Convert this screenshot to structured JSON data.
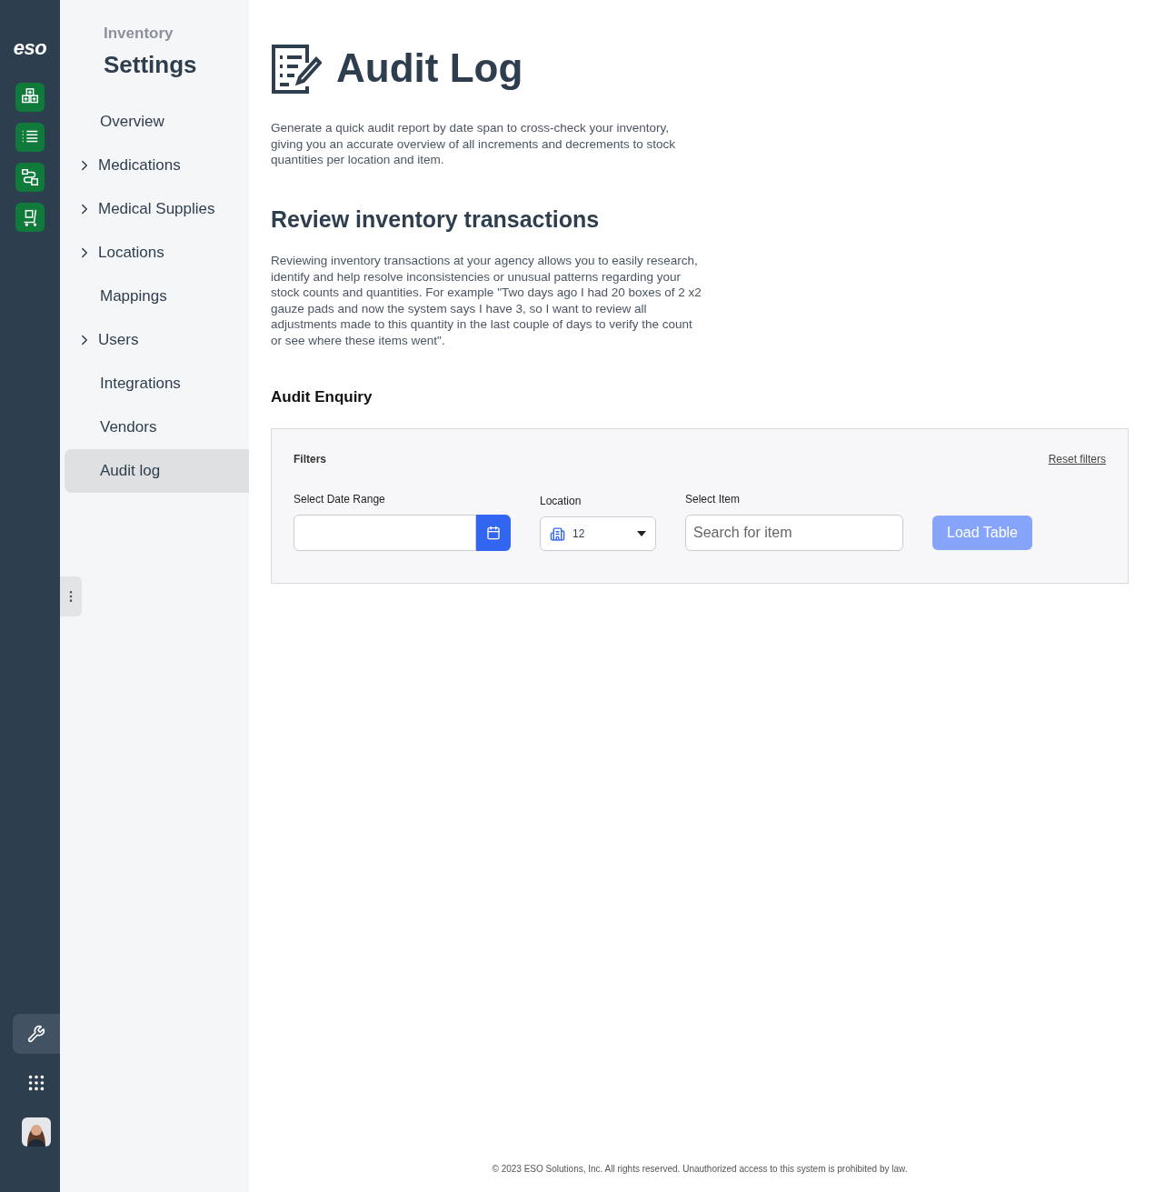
{
  "rail": {
    "logo": "eso",
    "apps": [
      {
        "kind": "boxes"
      },
      {
        "kind": "list"
      },
      {
        "kind": "flow"
      },
      {
        "kind": "cart"
      }
    ],
    "bottom": [
      {
        "kind": "wrench",
        "selected": true
      },
      {
        "kind": "grid",
        "selected": false
      },
      {
        "kind": "avatar",
        "selected": false
      }
    ]
  },
  "sidebar": {
    "subtitle": "Inventory",
    "title": "Settings",
    "items": [
      {
        "label": "Overview",
        "expandable": false,
        "selected": false
      },
      {
        "label": "Medications",
        "expandable": true,
        "selected": false
      },
      {
        "label": "Medical Supplies",
        "expandable": true,
        "selected": false
      },
      {
        "label": "Locations",
        "expandable": true,
        "selected": false
      },
      {
        "label": "Mappings",
        "expandable": false,
        "selected": false
      },
      {
        "label": "Users",
        "expandable": true,
        "selected": false
      },
      {
        "label": "Integrations",
        "expandable": false,
        "selected": false
      },
      {
        "label": "Vendors",
        "expandable": false,
        "selected": false
      },
      {
        "label": "Audit log",
        "expandable": false,
        "selected": true
      }
    ]
  },
  "page": {
    "title": "Audit Log",
    "intro": "Generate a quick audit report by date span to cross-check your inventory, giving you an accurate overview of all increments and decrements to stock quantities per location and item.",
    "section_title": "Review inventory transactions",
    "section_text": "Reviewing inventory transactions at your agency allows you to easily research, identify and help resolve inconsistencies or unusual patterns regarding your stock counts and quantities. For example \"Two days ago I had 20 boxes of 2 x2 gauze pads and now the system says I have 3, so I want to review all adjustments made to this quantity in the last couple of days to verify the count or see where these items went\".",
    "enquiry_title": "Audit Enquiry"
  },
  "filters": {
    "title": "Filters",
    "reset": "Reset filters",
    "date_label": "Select Date Range",
    "location_label": "Location",
    "location_value": "12",
    "item_label": "Select Item",
    "item_placeholder": "Search for item",
    "load_button": "Load Table",
    "load_disabled": true
  },
  "footer": "© 2023 ESO Solutions, Inc. All rights reserved. Unauthorized access to this system is prohibited by law."
}
